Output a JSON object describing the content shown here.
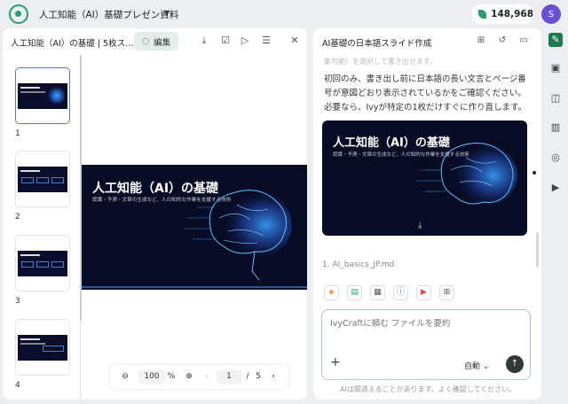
{
  "app": {
    "document_title": "人工知能（AI）基礎プレゼン資料",
    "credits": "148,968",
    "avatar_letter": "S"
  },
  "editor": {
    "title": "人工知能（AI）の基礎 | 5枚ス…",
    "edit_label": "編集",
    "thumbnails": [
      {
        "number": "1",
        "active": true
      },
      {
        "number": "2",
        "active": false
      },
      {
        "number": "3",
        "active": false
      },
      {
        "number": "4",
        "active": false
      }
    ],
    "slide": {
      "title": "人工知能（AI）の基礎",
      "subtitle": "認識・予測・文章の生成など、人の知的な作業を支援する技術"
    },
    "zoom": {
      "value": "100",
      "unit": "%",
      "page_current": "1",
      "page_separator": "/",
      "page_total": "5"
    }
  },
  "chat": {
    "title": "AI基礎の日本語スライド作成",
    "faded_text": "集可能）を選択して書き出せます。",
    "message": "初回のみ、書き出し前に日本語の長い文言とページ番号が意図どおり表示されているかをご確認ください。必要なら、Ivyが特定の1枚だけすぐに作り直します。",
    "card": {
      "title": "人工知能（AI）の基礎",
      "subtitle": "認識・予測・文章の生成など、人の知的な作業を支援する技術"
    },
    "attachment": "1.  AI_basics_JP.md",
    "input_placeholder": "IvyCraftに頼む ファイルを要約",
    "mode_label": "自動",
    "disclaimer": "AIは間違えることがあります。よく確認してください。"
  },
  "colors": {
    "accent": "#2a9d6a",
    "slide_bg": "#070b24",
    "active_border": "#4a7fe0"
  }
}
